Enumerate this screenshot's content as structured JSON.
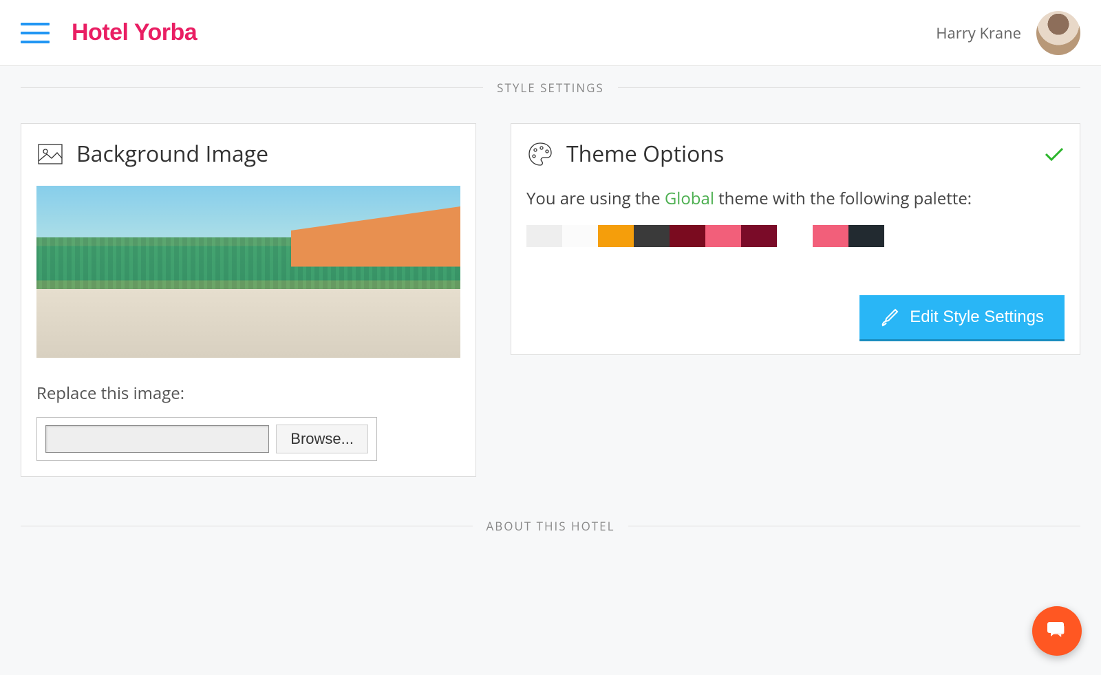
{
  "header": {
    "brand": "Hotel Yorba",
    "user_name": "Harry Krane"
  },
  "sections": {
    "style_settings_heading": "STYLE SETTINGS",
    "about_heading": "ABOUT THIS HOTEL"
  },
  "background_card": {
    "title": "Background Image",
    "replace_label": "Replace this image:",
    "browse_label": "Browse..."
  },
  "theme_card": {
    "title": "Theme Options",
    "text_prefix": "You are using the ",
    "theme_name": "Global",
    "text_suffix": " theme with the following palette:",
    "palette": [
      "#eeeeee",
      "#fbfbfb",
      "#f59e0b",
      "#3a3a3a",
      "#7a0b1f",
      "#f25f7a",
      "#7a0b28",
      "gap",
      "#f25f7a",
      "#222a30"
    ],
    "edit_button": "Edit Style Settings"
  }
}
